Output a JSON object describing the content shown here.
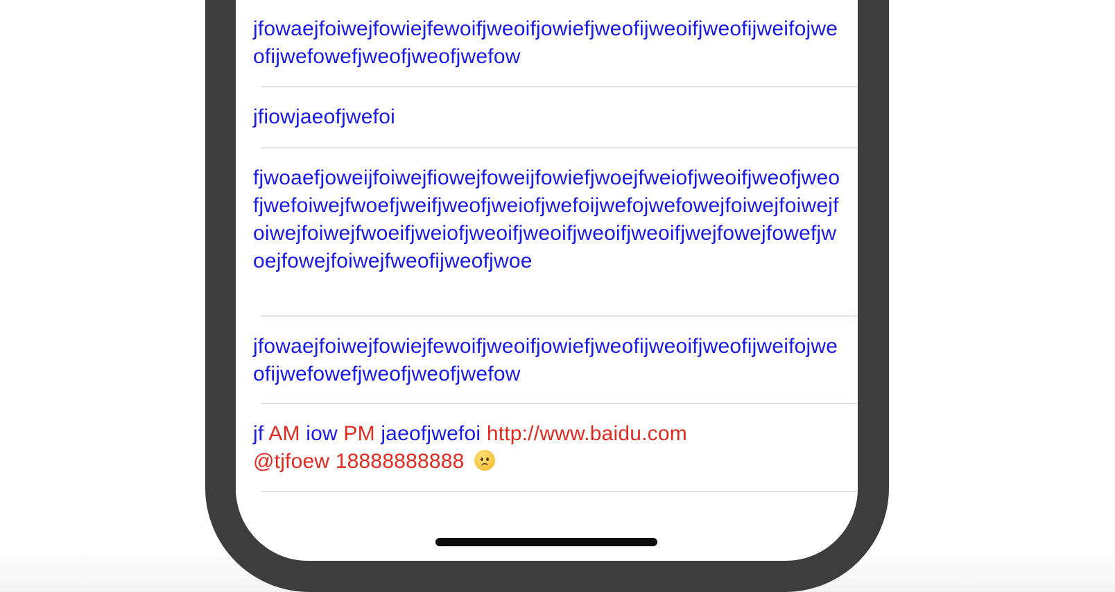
{
  "cells": [
    {
      "text": "jfowaejfoiwejfowiejfewoifjweoifjowiefjweofijweoifjweofijweifojweofijwefowefjweofjweofjwefow"
    },
    {
      "text": "jfiowjaeofjwefoi"
    },
    {
      "text": "fjwoaefjoweijfoiwejfiowejfoweijfowiefjwoejfweiofjweoifjweofjweofjwefoiwejfwoefjweifjweofjweiofjwefoijwefojwefowejfoiwejfoiwejfoiwejfoiwejfwoeifjweiofjweoifjweoifjweoifjweoifjwejfowejfowefjwoejfowejfoiwejfweofijweofjwoe"
    },
    {
      "text": "jfowaejfoiwejfowiejfewoifjweoifjowiefjweofijweoifjweofijweifojweofijwefowefjweofjweofjwefow"
    }
  ],
  "rich_cell": {
    "t1": "jf ",
    "am": "AM",
    "t2": " iow ",
    "pm": "PM",
    "t3": " jaeofjwefoi ",
    "url": "http://www.baidu.com",
    "mention": "@tjfoew",
    "phone": "18888888888",
    "emoji_icon": "worried-face-emoji-icon"
  },
  "colors": {
    "text": "#1a1ae6",
    "link": "#e02a20",
    "device_frame": "#3d3d3d"
  }
}
